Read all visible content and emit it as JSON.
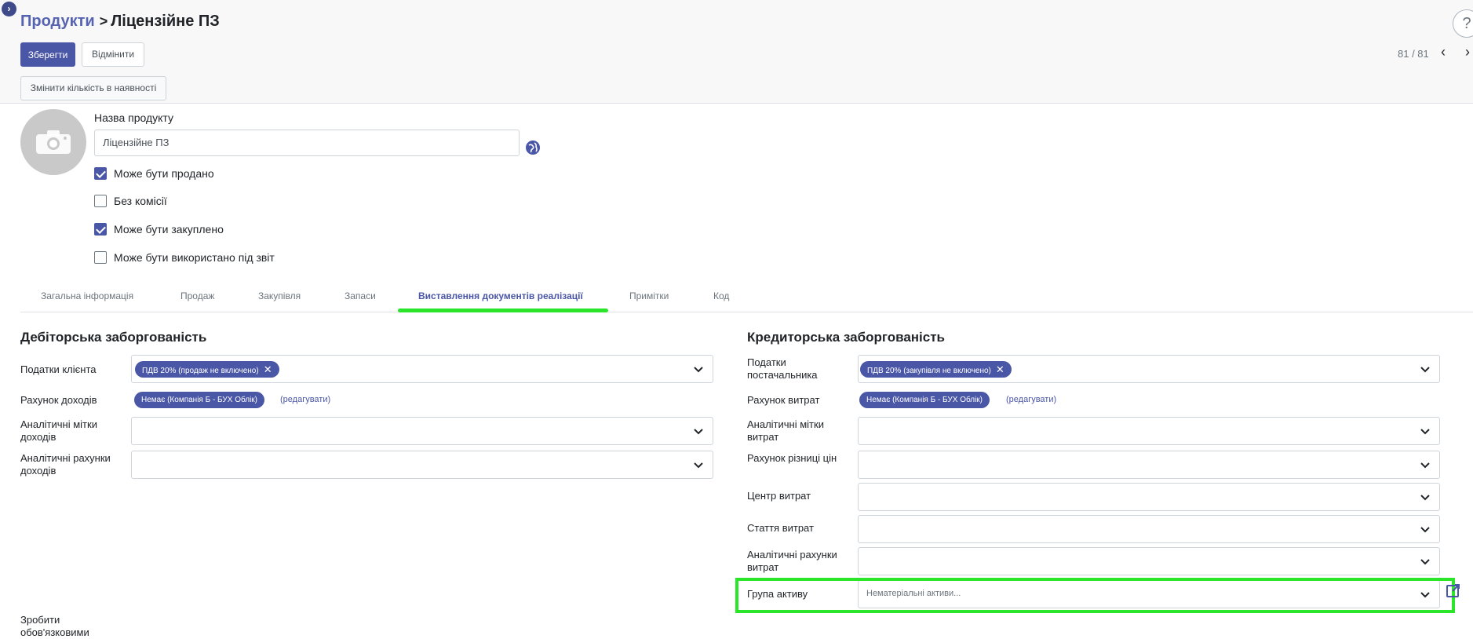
{
  "breadcrumb": {
    "parent": "Продукти",
    "separator": ">",
    "current": "Ліцензійне ПЗ"
  },
  "toolbar": {
    "save_label": "Зберегти",
    "discard_label": "Відмінити",
    "update_qty_label": "Змінити кількість в наявності",
    "help_label": "?"
  },
  "pager": {
    "value": "81 / 81",
    "prev": "‹",
    "next": "›"
  },
  "product": {
    "name_label": "Назва продукту",
    "name_placeholder": "Ліцензійне ПЗ",
    "options": [
      {
        "label": "Може бути продано",
        "checked": true
      },
      {
        "label": "Без комісії",
        "checked": false
      },
      {
        "label": "Може бути закуплено",
        "checked": true
      },
      {
        "label": "Може бути використано під звіт",
        "checked": false
      }
    ]
  },
  "tabs": [
    "Загальна інформація",
    "Продаж",
    "Закупівля",
    "Запаси",
    "Виставлення документів реалізації",
    "Примітки",
    "Код"
  ],
  "active_tab": "Виставлення документів реалізації",
  "receivable": {
    "title": "Дебіторська заборгованість",
    "customer_taxes_label": "Податки клієнта",
    "customer_taxes_tag": "ПДВ 20% (продаж не включено)",
    "income_account_label": "Рахунок доходів",
    "income_account_tag": "Немає (Компанія Б - БУХ Облік)",
    "edit_link": "(редагувати)",
    "income_tags_label": "Аналітичні мітки доходів",
    "income_analytic_label": "Аналітичні рахунки доходів"
  },
  "payable": {
    "title": "Кредиторська заборгованість",
    "vendor_taxes_label": "Податки постачальника",
    "vendor_taxes_tag": "ПДВ 20% (закупівля не включено)",
    "expense_account_label": "Рахунок витрат",
    "expense_account_tag": "Немає (Компанія Б - БУХ Облік)",
    "edit_link": "(редагувати)",
    "expense_tags_label": "Аналітичні мітки витрат",
    "price_diff_label": "Рахунок різниці цін",
    "cost_center_label": "Центр витрат",
    "expense_item_label": "Стаття витрат",
    "expense_analytic_label": "Аналітичні рахунки витрат",
    "asset_group_label": "Група активу",
    "asset_group_placeholder": "Нематеріальні активи..."
  },
  "footer": {
    "obligations_label": "Зробити обов'язковими"
  },
  "colors": {
    "primary": "#4a56a6",
    "highlight": "#2ae52a"
  }
}
